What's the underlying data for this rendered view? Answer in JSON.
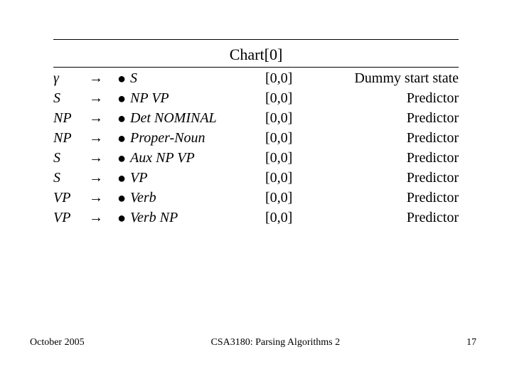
{
  "chart_data": {
    "type": "table",
    "title": "Chart[0]",
    "columns": [
      "lhs",
      "rhs",
      "span",
      "action"
    ],
    "rows": [
      {
        "lhs": "γ",
        "rhs": "S",
        "span": "[0,0]",
        "action": "Dummy start state"
      },
      {
        "lhs": "S",
        "rhs": "NP VP",
        "span": "[0,0]",
        "action": "Predictor"
      },
      {
        "lhs": "NP",
        "rhs": "Det NOMINAL",
        "span": "[0,0]",
        "action": "Predictor"
      },
      {
        "lhs": "NP",
        "rhs": "Proper-Noun",
        "span": "[0,0]",
        "action": "Predictor"
      },
      {
        "lhs": "S",
        "rhs": "Aux NP VP",
        "span": "[0,0]",
        "action": "Predictor"
      },
      {
        "lhs": "S",
        "rhs": "VP",
        "span": "[0,0]",
        "action": "Predictor"
      },
      {
        "lhs": "VP",
        "rhs": "Verb",
        "span": "[0,0]",
        "action": "Predictor"
      },
      {
        "lhs": "VP",
        "rhs": "Verb NP",
        "span": "[0,0]",
        "action": "Predictor"
      }
    ]
  },
  "symbols": {
    "arrow": "→",
    "dot": "●"
  },
  "footer": {
    "left": "October 2005",
    "center": "CSA3180: Parsing Algorithms 2",
    "right": "17"
  }
}
